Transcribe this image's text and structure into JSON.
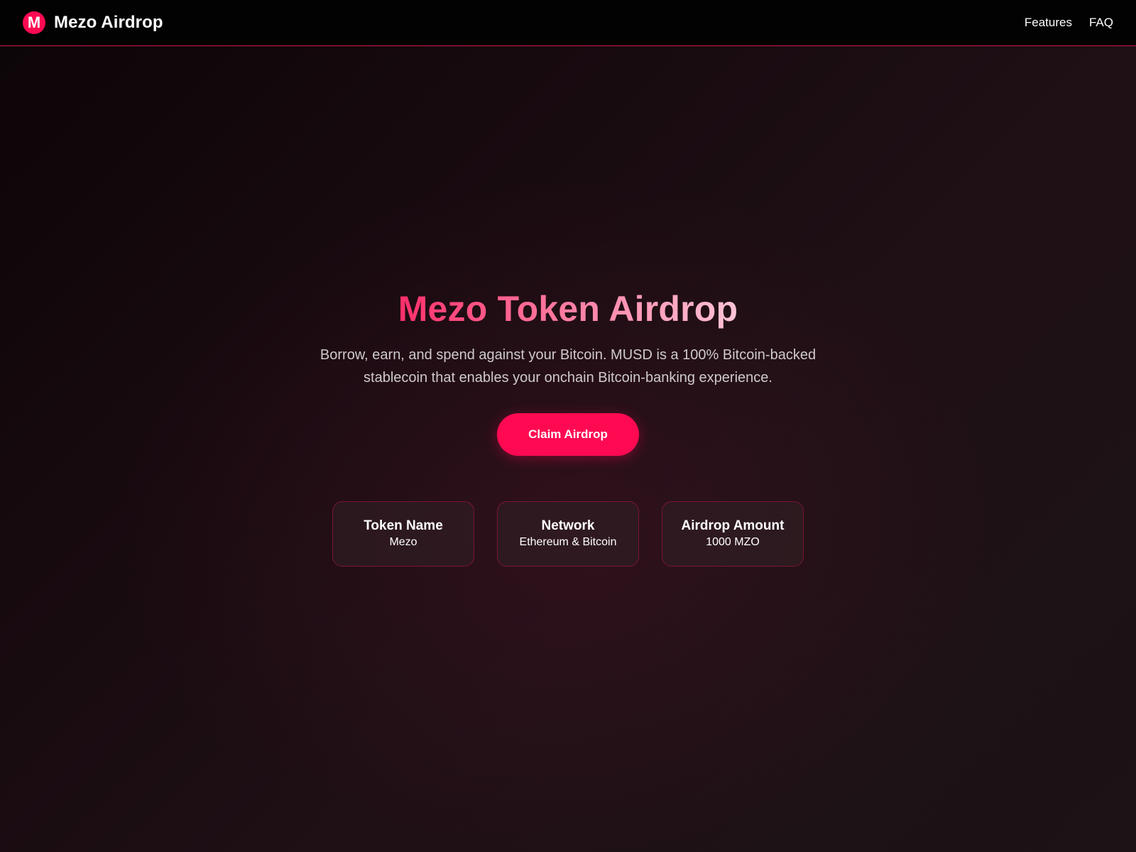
{
  "header": {
    "logo_letter": "M",
    "brand_name": "Mezo Airdrop",
    "nav": [
      {
        "label": "Features"
      },
      {
        "label": "FAQ"
      }
    ]
  },
  "hero": {
    "title": "Mezo Token Airdrop",
    "subtitle": "Borrow, earn, and spend against your Bitcoin. MUSD is a 100% Bitcoin-backed stablecoin that enables your onchain Bitcoin-banking experience.",
    "cta_label": "Claim Airdrop"
  },
  "info_cards": [
    {
      "title": "Token Name",
      "value": "Mezo"
    },
    {
      "title": "Network",
      "value": "Ethereum & Bitcoin"
    },
    {
      "title": "Airdrop Amount",
      "value": "1000 MZO"
    }
  ],
  "colors": {
    "accent": "#ff0a52",
    "nav_border": "#d1184a",
    "card_border": "#7a1530",
    "background": "#170a0f"
  }
}
